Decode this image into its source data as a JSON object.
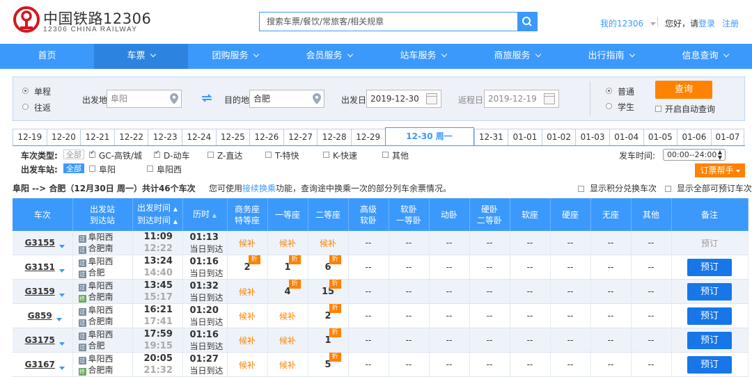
{
  "header": {
    "logo_cn": "中国铁路12306",
    "logo_en": "12306 CHINA RAILWAY",
    "search_placeholder": "搜索车票/餐饮/常旅客/相关规章",
    "my12306": "我的12306",
    "greeting": "您好，请",
    "login": "登录",
    "register": "注册"
  },
  "nav": {
    "items": [
      {
        "label": "首页",
        "has_caret": false,
        "active": false
      },
      {
        "label": "车票",
        "has_caret": true,
        "active": true
      },
      {
        "label": "团购服务",
        "has_caret": true,
        "active": false
      },
      {
        "label": "会员服务",
        "has_caret": true,
        "active": false
      },
      {
        "label": "站车服务",
        "has_caret": true,
        "active": false
      },
      {
        "label": "商旅服务",
        "has_caret": true,
        "active": false
      },
      {
        "label": "出行指南",
        "has_caret": true,
        "active": false
      },
      {
        "label": "信息查询",
        "has_caret": true,
        "active": false
      }
    ]
  },
  "query": {
    "oneway": "单程",
    "roundtrip": "往返",
    "from_label": "出发地",
    "from_value": "阜阳",
    "to_label": "目的地",
    "to_value": "合肥",
    "depart_label": "出发日",
    "depart_value": "2019-12-30",
    "return_label": "返程日",
    "return_value": "2019-12-19",
    "normal": "普通",
    "student": "学生",
    "query_btn": "查询",
    "auto_query": "开启自动查询"
  },
  "dates": [
    "12-19",
    "12-20",
    "12-21",
    "12-22",
    "12-23",
    "12-24",
    "12-25",
    "12-26",
    "12-27",
    "12-28",
    "12-29",
    "12-30 周一",
    "12-31",
    "01-01",
    "01-02",
    "01-03",
    "01-04",
    "01-05",
    "01-06",
    "01-07"
  ],
  "filters": {
    "type_label": "车次类型:",
    "all": "全部",
    "types": [
      "GC-高铁/城",
      "D-动车",
      "Z-直达",
      "T-特快",
      "K-快速",
      "其他"
    ],
    "station_label": "出发车站:",
    "stations": [
      "阜阳",
      "阜阳西"
    ],
    "time_label": "发车时间:",
    "time_value": "00:00--24:00",
    "help_btn": "订票帮手"
  },
  "route": {
    "text": "阜阳 --> 合肥（12月30日  周一）共计",
    "count": "46",
    "suffix": "个车次",
    "tip_pre": "您可使用",
    "tip_link": "接续换乘",
    "tip_post": "功能，查询途中换乘一次的部分列车余票情况。",
    "opt1": "显示积分兑换车次",
    "opt2": "显示全部可预订车次"
  },
  "columns": {
    "train": "车次",
    "station1": "出发站",
    "station2": "到达站",
    "time1": "出发时间",
    "time2": "到达时间",
    "duration": "历时",
    "biz1": "商务座",
    "biz2": "特等座",
    "first": "一等座",
    "second": "二等座",
    "adv1": "高级",
    "adv2": "软卧",
    "sleeper1": "软卧",
    "sleeper2": "一等卧",
    "dong": "动卧",
    "hard1": "硬卧",
    "hard2": "二等卧",
    "soft_seat": "软座",
    "hard_seat": "硬座",
    "no_seat": "无座",
    "other": "其他",
    "remark": "备注"
  },
  "icons": {
    "from": "始",
    "pass": "过",
    "end": "终"
  },
  "labels": {
    "waitlist": "候补",
    "discount": "折",
    "none": "--",
    "book": "预订",
    "same_day": "当日到达"
  },
  "trains": [
    {
      "no": "G3155",
      "from": "阜阳西",
      "from_icon": "过",
      "to": "合肥南",
      "to_icon": "过",
      "dep": "11:09",
      "arr": "12:22",
      "dur": "01:13",
      "biz": "候补",
      "first": "候补",
      "second": "候补",
      "biz_zhe": false,
      "first_zhe": false,
      "second_zhe": false,
      "bookable": false
    },
    {
      "no": "G3151",
      "from": "阜阳西",
      "from_icon": "过",
      "to": "合肥",
      "to_icon": "过",
      "dep": "13:24",
      "arr": "14:40",
      "dur": "01:16",
      "biz": "2",
      "first": "1",
      "second": "6",
      "biz_zhe": true,
      "first_zhe": true,
      "second_zhe": true,
      "bookable": true
    },
    {
      "no": "G3159",
      "from": "阜阳西",
      "from_icon": "过",
      "to": "合肥南",
      "to_icon": "终",
      "dep": "13:45",
      "arr": "15:17",
      "dur": "01:32",
      "biz": "候补",
      "first": "4",
      "second": "15",
      "biz_zhe": false,
      "first_zhe": true,
      "second_zhe": true,
      "bookable": true
    },
    {
      "no": "G859",
      "from": "阜阳西",
      "from_icon": "过",
      "to": "合肥南",
      "to_icon": "过",
      "dep": "16:21",
      "arr": "17:41",
      "dur": "01:20",
      "biz": "候补",
      "first": "候补",
      "second": "2",
      "biz_zhe": false,
      "first_zhe": false,
      "second_zhe": true,
      "bookable": true
    },
    {
      "no": "G3175",
      "from": "阜阳西",
      "from_icon": "过",
      "to": "合肥",
      "to_icon": "过",
      "dep": "17:59",
      "arr": "19:15",
      "dur": "01:16",
      "biz": "候补",
      "first": "候补",
      "second": "1",
      "biz_zhe": false,
      "first_zhe": false,
      "second_zhe": true,
      "bookable": true
    },
    {
      "no": "G3167",
      "from": "阜阳西",
      "from_icon": "过",
      "to": "合肥南",
      "to_icon": "终",
      "dep": "20:05",
      "arr": "21:32",
      "dur": "01:27",
      "biz": "候补",
      "first": "候补",
      "second": "5",
      "biz_zhe": false,
      "first_zhe": false,
      "second_zhe": true,
      "bookable": true
    }
  ],
  "colors": {
    "primary": "#3b99fc",
    "accent": "#ff8200",
    "book": "#1776e8"
  }
}
